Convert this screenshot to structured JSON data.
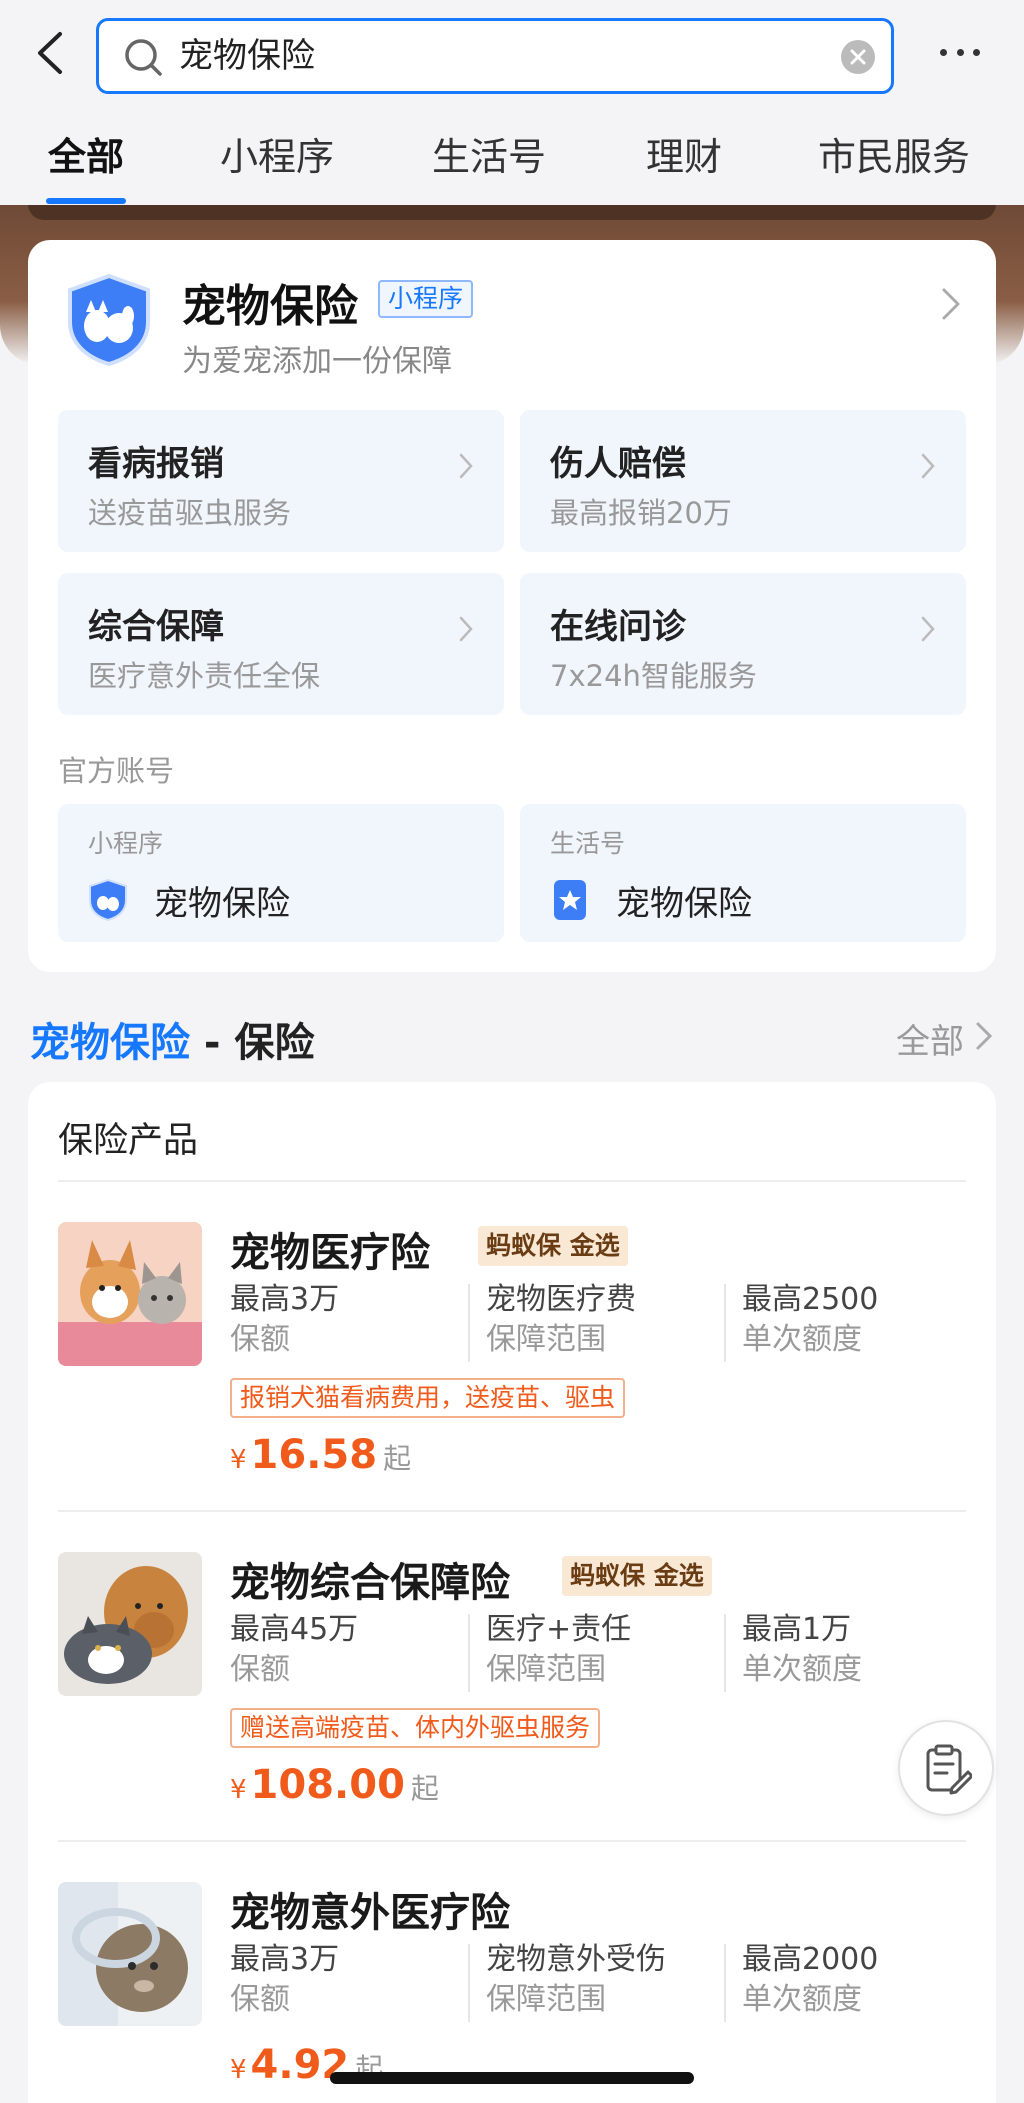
{
  "search": {
    "query": "宠物保险"
  },
  "tabs": [
    "全部",
    "小程序",
    "生活号",
    "理财",
    "市民服务"
  ],
  "mini_program": {
    "name": "宠物保险",
    "badge": "小程序",
    "subtitle": "为爱宠添加一份保障",
    "services": [
      {
        "title": "看病报销",
        "sub": "送疫苗驱虫服务"
      },
      {
        "title": "伤人赔偿",
        "sub": "最高报销20万"
      },
      {
        "title": "综合保障",
        "sub": "医疗意外责任全保"
      },
      {
        "title": "在线问诊",
        "sub": "7x24h智能服务"
      }
    ],
    "official_label": "官方账号",
    "accounts": [
      {
        "type": "小程序",
        "name": "宠物保险"
      },
      {
        "type": "生活号",
        "name": "宠物保险"
      }
    ]
  },
  "section": {
    "highlight": "宠物保险",
    "rest": " - 保险",
    "more": "全部"
  },
  "products_header": "保险产品",
  "products": [
    {
      "name": "宠物医疗险",
      "tag": "蚂蚁保 金选",
      "specs": [
        {
          "value": "最高3万",
          "label": "保额"
        },
        {
          "value": "宠物医疗费",
          "label": "保障范围"
        },
        {
          "value": "最高2500",
          "label": "单次额度"
        }
      ],
      "promo": "报销犬猫看病费用，送疫苗、驱虫",
      "currency": "¥",
      "price": "16.58",
      "price_suffix": "起"
    },
    {
      "name": "宠物综合保障险",
      "tag": "蚂蚁保 金选",
      "specs": [
        {
          "value": "最高45万",
          "label": "保额"
        },
        {
          "value": "医疗+责任",
          "label": "保障范围"
        },
        {
          "value": "最高1万",
          "label": "单次额度"
        }
      ],
      "promo": "赠送高端疫苗、体内外驱虫服务",
      "currency": "¥",
      "price": "108.00",
      "price_suffix": "起"
    },
    {
      "name": "宠物意外医疗险",
      "specs": [
        {
          "value": "最高3万",
          "label": "保额"
        },
        {
          "value": "宠物意外受伤",
          "label": "保障范围"
        },
        {
          "value": "最高2000",
          "label": "单次额度"
        }
      ],
      "currency": "¥",
      "price": "4.92",
      "price_suffix": "起"
    }
  ],
  "colors": {
    "accent": "#1677ff",
    "price": "#f05b1b",
    "tag_bg": "#f9e8d4"
  },
  "icons": [
    "back-icon",
    "search-icon",
    "clear-icon",
    "more-icon",
    "shield-pet-icon",
    "chevron-right-icon",
    "star-badge-icon",
    "edit-note-icon"
  ]
}
